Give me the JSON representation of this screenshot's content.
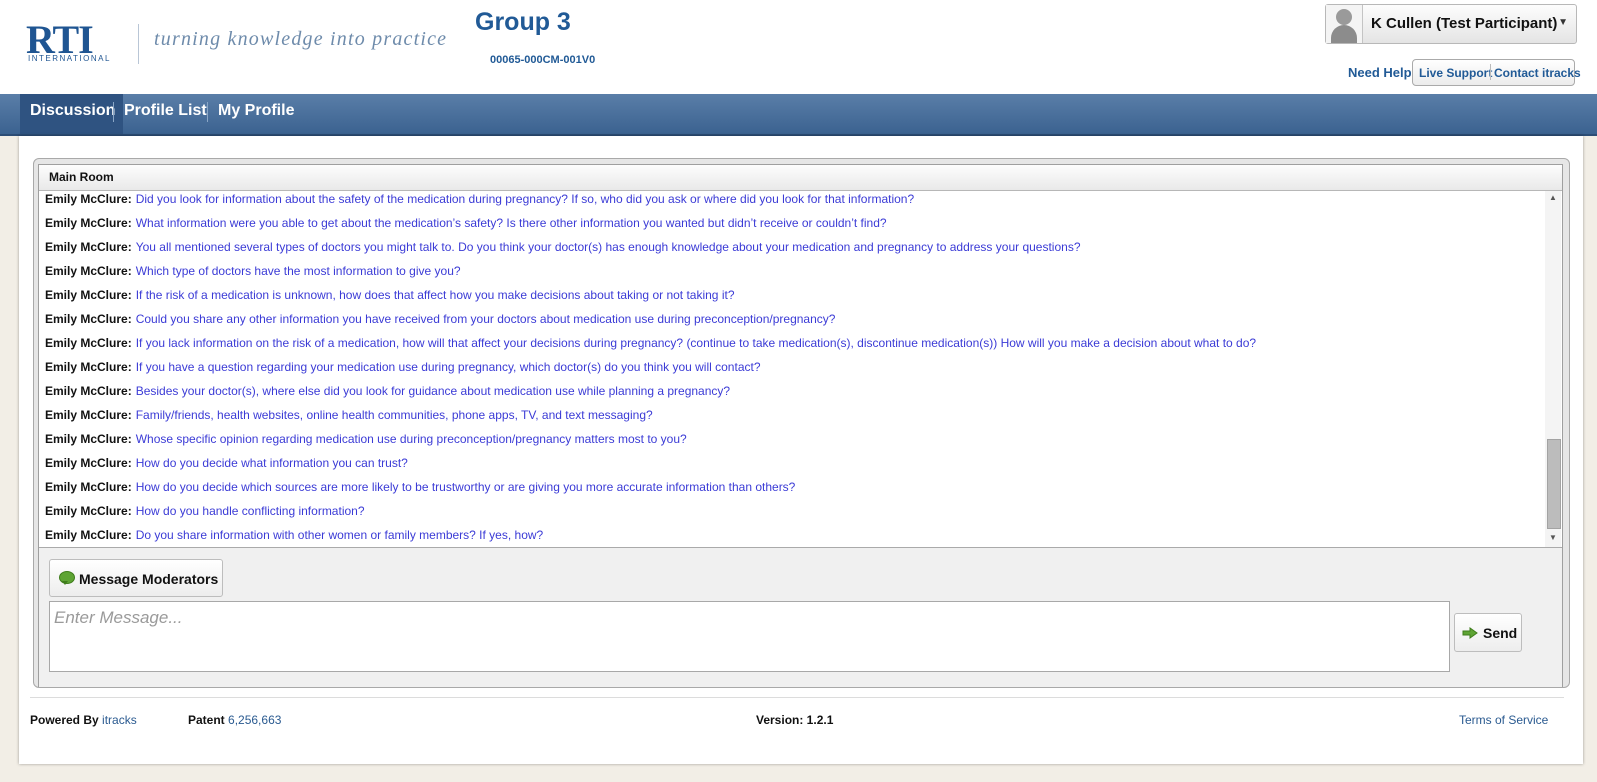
{
  "header": {
    "logo_text": "RTI",
    "logo_subtext": "INTERNATIONAL",
    "tagline": "turning knowledge into practice",
    "group_title": "Group 3",
    "study_code": "00065-000CM-001V0",
    "user_name": "K Cullen (Test Participant)",
    "need_help": "Need Help?",
    "live_support": "Live Support",
    "contact": "Contact itracks"
  },
  "nav": {
    "items": [
      {
        "label": "Discussion",
        "active": true
      },
      {
        "label": "Profile List",
        "active": false
      },
      {
        "label": "My Profile",
        "active": false
      }
    ]
  },
  "room": {
    "title": "Main Room",
    "messages": [
      {
        "author": "Emily McClure:",
        "text": "Did you look for information about the safety of the medication during pregnancy? If so, who did you ask or where did you look for that information?"
      },
      {
        "author": "Emily McClure:",
        "text": "What information were you able to get about the medication’s safety? Is there other information you wanted but didn’t receive or couldn’t find?"
      },
      {
        "author": "Emily McClure:",
        "text": "You all mentioned several types of doctors you might talk to. Do you think your doctor(s) has enough knowledge about your medication and pregnancy to address your questions?"
      },
      {
        "author": "Emily McClure:",
        "text": "Which type of doctors have the most information to give you?"
      },
      {
        "author": "Emily McClure:",
        "text": "If the risk of a medication is unknown, how does that affect how you make decisions about taking or not taking it?"
      },
      {
        "author": "Emily McClure:",
        "text": "Could you share any other information you have received from your doctors about medication use during preconception/pregnancy?"
      },
      {
        "author": "Emily McClure:",
        "text": "If you lack information on the risk of a medication, how will that affect your decisions during pregnancy? (continue to take medication(s), discontinue medication(s)) How will you make a decision about what to do?"
      },
      {
        "author": "Emily McClure:",
        "text": "If you have a question regarding your medication use during pregnancy, which doctor(s) do you think you will contact?"
      },
      {
        "author": "Emily McClure:",
        "text": "Besides your doctor(s), where else did you look for guidance about medication use while planning a pregnancy?"
      },
      {
        "author": "Emily McClure:",
        "text": "Family/friends, health websites, online health communities, phone apps, TV, and text messaging?"
      },
      {
        "author": "Emily McClure:",
        "text": "Whose specific opinion regarding medication use during preconception/pregnancy matters most to you?"
      },
      {
        "author": "Emily McClure:",
        "text": "How do you decide what information you can trust?"
      },
      {
        "author": "Emily McClure:",
        "text": "How do you decide which sources are more likely to be trustworthy or are giving you more accurate information than others?"
      },
      {
        "author": "Emily McClure:",
        "text": "How do you handle conflicting information?"
      },
      {
        "author": "Emily McClure:",
        "text": "Do you share information with other women or family members? If yes, how?"
      }
    ]
  },
  "compose": {
    "moderators_label": "Message Moderators",
    "placeholder": "Enter Message...",
    "send_label": "Send"
  },
  "footer": {
    "powered_label": "Powered By",
    "powered_link": "itracks",
    "patent_label": "Patent",
    "patent_number": "6,256,663",
    "version": "Version: 1.2.1",
    "terms": "Terms of Service"
  },
  "colors": {
    "brand_blue": "#215a96",
    "nav_blue": "#3b6290",
    "message_text": "#3b3bd6",
    "icon_green": "#5ea434"
  },
  "icons": {
    "moderators": "speech-bubble-icon",
    "send": "green-arrow-icon",
    "user": "user-silhouette-icon",
    "dropdown": "caret-down-icon"
  }
}
